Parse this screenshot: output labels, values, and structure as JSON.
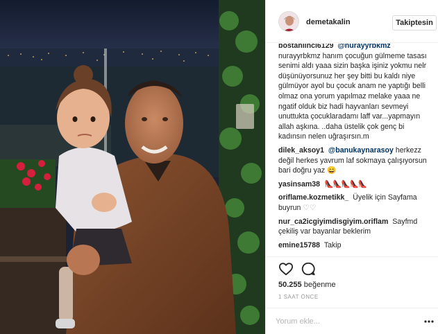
{
  "post": {
    "photo": {
      "icon": "photo-image",
      "colors": {
        "sky": "#18233a",
        "city_lights": "#d9b25a",
        "jacket": "#7a4526",
        "dress": "#e6e2e6"
      }
    },
    "header": {
      "username": "demetakalin",
      "follow_label": "Takiptesin",
      "avatar_icon": "avatar-icon"
    },
    "comments": [
      {
        "user": "bostanlinci6129",
        "mention": "@nurayyrbkmz",
        "text": "nurayyrbkmz hanım çocuğun gülmeme tasası senimi aldı yaaa sizin başka işiniz yokmu nelr düşünüyorsunuz her şey bitti bu kaldı niye gülmüyor ayol bu çocuk anam ne yaptığı belli olmaz ona yorum yapılmaz melake yaaa ne ngatif olduk biz hadi hayvanları sevmeyi unuttukta çocuklaradamı laff var...yapmayın allah aşkına. ..daha üstelik çok genç bi kadınsın nelen uğraşırsın.m"
      },
      {
        "user": "dilek_aksoy1",
        "mention": "@banukaynarasoy",
        "text": "herkezz değil herkes yavrum laf sokmaya çalışıyorsun bari doğru yaz",
        "emoji": "😄"
      },
      {
        "user": "yasinsam38",
        "heels": "👠👠👠👠👠"
      },
      {
        "user": "oriflame.kozmetikk_",
        "text": "Üyelik için Sayfama buyrun",
        "emoji": "♡♡"
      },
      {
        "user": "nur_ca2icgiyimdisgiyim.oriflam",
        "text": "Sayfmd çekiliş var bayanlar beklerim"
      },
      {
        "user": "emine15788",
        "text": "Takip"
      }
    ],
    "actions": {
      "like_icon": "heart-icon",
      "comment_icon": "comment-bubble-icon",
      "likes_count": "50.255",
      "likes_label": "beğenme",
      "time_ago": "1 SAAT ÖNCE"
    },
    "add_comment": {
      "placeholder": "Yorum ekle...",
      "more_icon": "more-options-icon"
    }
  }
}
